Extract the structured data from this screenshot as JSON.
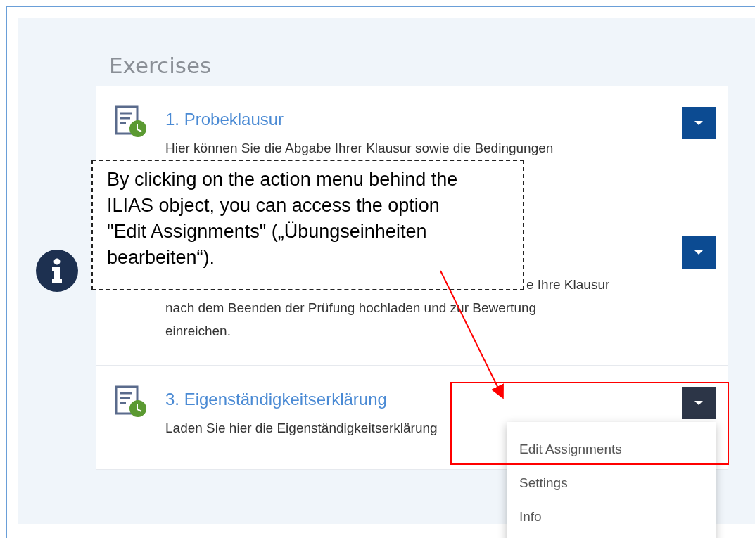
{
  "section_title": "Exercises",
  "items": [
    {
      "title": "1. Probeklausur",
      "description_lines": [
        "Hier können Sie die Abgabe Ihrer Klausur sowie die Bedingungen"
      ],
      "menu_open": false
    },
    {
      "description_lines": [
        "e Ihre Klausur",
        "nach dem Beenden der Prüfung hochladen und zur Bewertung",
        "einreichen."
      ],
      "menu_open": false
    },
    {
      "title": "3. Eigenständigkeitserklärung",
      "description_lines": [
        "Laden Sie hier die Eigenständigkeitserklärung"
      ],
      "menu_open": true
    }
  ],
  "action_menu": [
    "Edit Assignments",
    "Settings",
    "Info"
  ],
  "callout": {
    "text": "By clicking on the action menu behind the ILIAS object, you can access the option \"Edit Assignments\" („Übungseinheiten bearbeiten“)."
  }
}
